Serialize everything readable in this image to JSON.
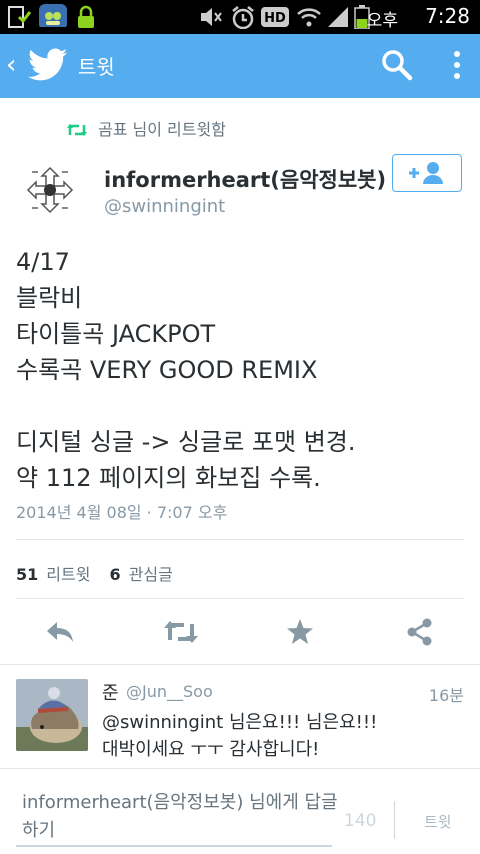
{
  "status_bar": {
    "ampm": "오후",
    "time": "7:28",
    "icons": [
      "sim-card-icon",
      "app-notification-icon",
      "lock-icon",
      "mute-icon",
      "alarm-icon",
      "hd-icon",
      "wifi-icon",
      "signal-icon",
      "battery-icon"
    ]
  },
  "header": {
    "back_icon": "chevron-left-icon",
    "logo_icon": "twitter-bird-icon",
    "title": "트윗",
    "search_icon": "search-icon",
    "overflow_icon": "more-vert-icon",
    "color": "#55acee"
  },
  "retweet_context": {
    "text": "곰표 님이 리트윗함",
    "icon": "retweet-icon",
    "icon_color": "#19cf86"
  },
  "tweet": {
    "author_name": "informerheart(음악정보봇)",
    "author_handle": "@swinningint",
    "follow_icon": "add-user-icon",
    "text": "4/17\n블락비\n타이틀곡 JACKPOT\n수록곡 VERY GOOD REMIX\n\n디지털 싱글 -> 싱글로 포맷 변경.\n약 112 페이지의 화보집 수록.",
    "date": "2014년 4월 08일 · 7:07 오후",
    "retweet_count": "51",
    "retweet_label": "리트윗",
    "favorite_count": "6",
    "favorite_label": "관심글"
  },
  "actions": [
    "reply-icon",
    "retweet-icon",
    "star-icon",
    "share-icon"
  ],
  "reply": {
    "name": "준",
    "handle": "@Jun__Soo",
    "time": "16분",
    "text": "@swinningint 님은요!!! 님은요!!!\n대박이세요 ㅜㅜ 감사합니다!"
  },
  "compose": {
    "placeholder": "informerheart(음악정보봇) 님에게 답글하기",
    "char_count": "140",
    "send_label": "트윗"
  }
}
